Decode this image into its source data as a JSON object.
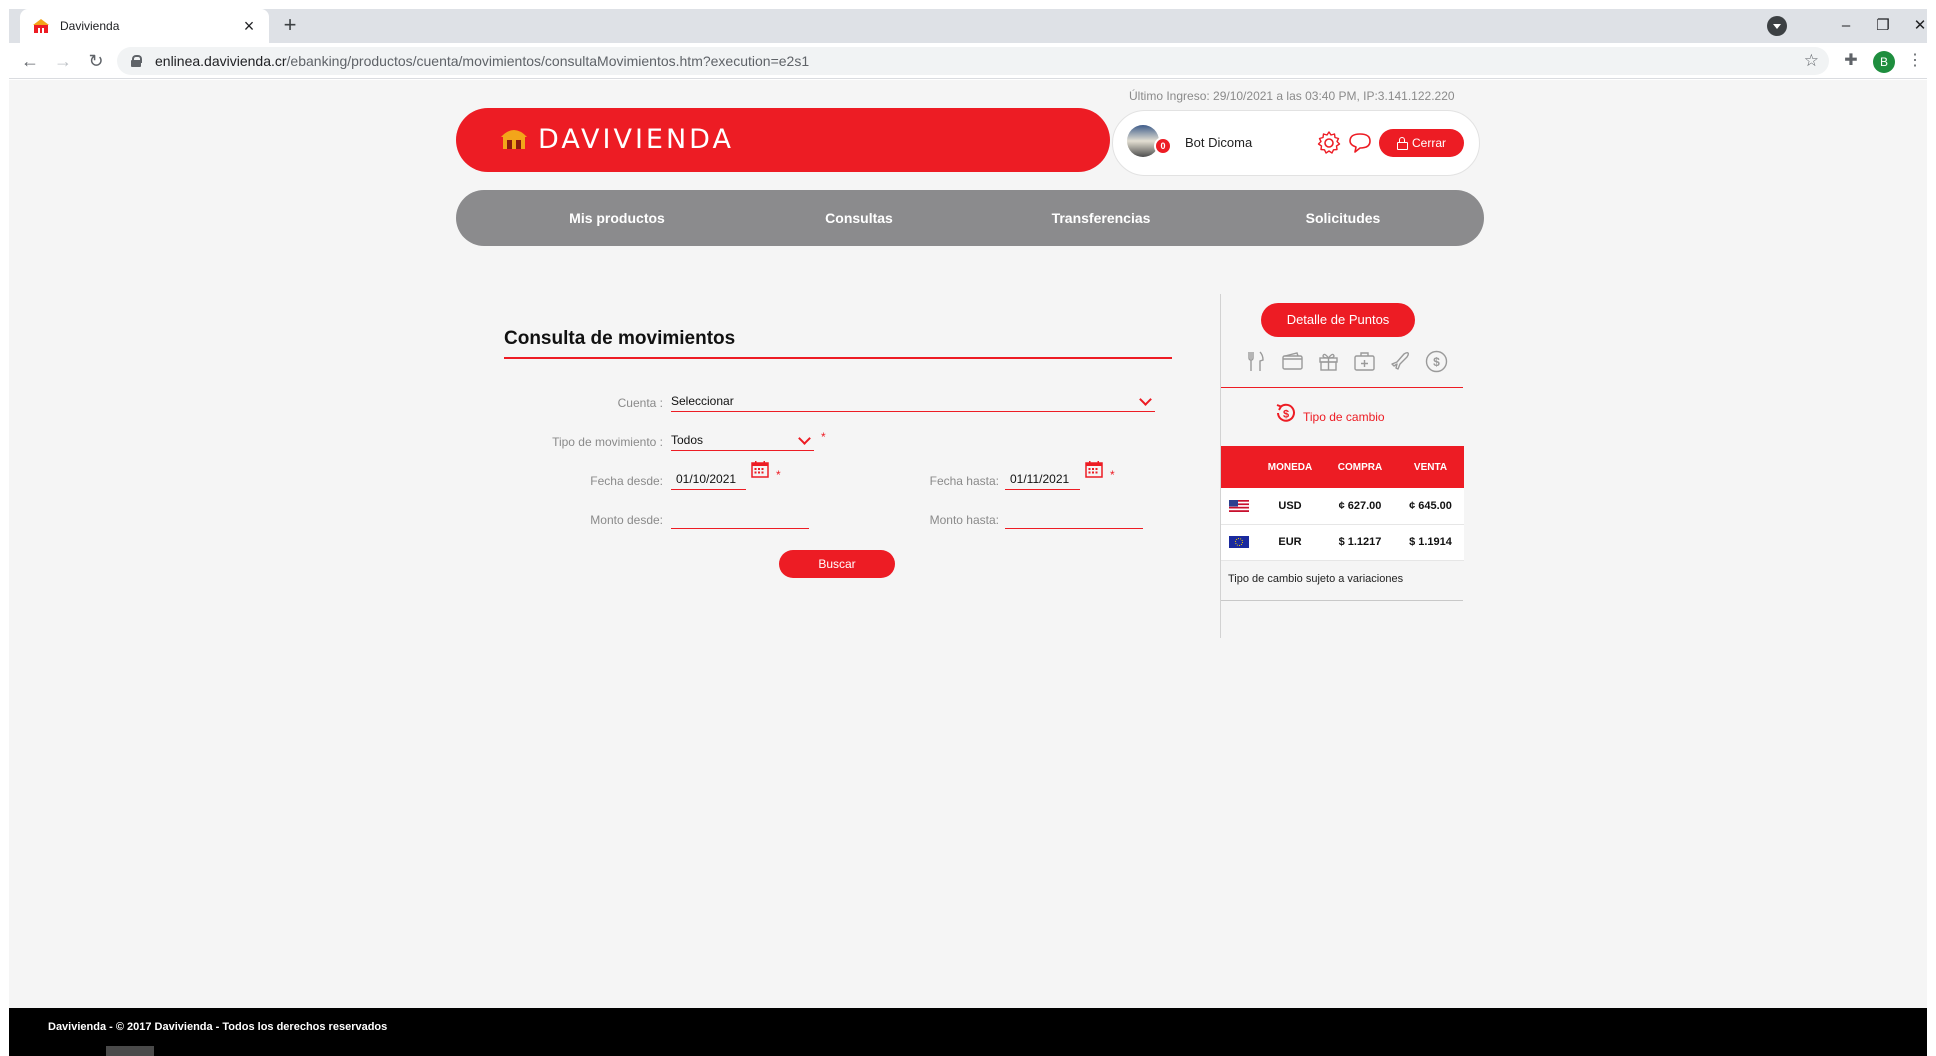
{
  "browser": {
    "tab_title": "Davivienda",
    "url_domain": "enlinea.davivienda.cr",
    "url_path": "/ebanking/productos/cuenta/movimientos/consultaMovimientos.htm?execution=e2s1",
    "profile_initial": "B"
  },
  "header": {
    "last_login": "Último Ingreso: 29/10/2021 a las 03:40 PM, IP:3.141.122.220",
    "brand": "DAVIVIENDA",
    "user_name": "Bot Dicoma",
    "notifications": "0",
    "logout_label": "Cerrar"
  },
  "nav": {
    "items": [
      "Mis productos",
      "Consultas",
      "Transferencias",
      "Solicitudes"
    ]
  },
  "form": {
    "title": "Consulta de movimientos",
    "cuenta_label": "Cuenta :",
    "cuenta_value": "Seleccionar",
    "tipo_label": "Tipo de movimiento :",
    "tipo_value": "Todos",
    "fecha_desde_label": "Fecha desde:",
    "fecha_desde_value": "01/10/2021",
    "fecha_hasta_label": "Fecha hasta:",
    "fecha_hasta_value": "01/11/2021",
    "monto_desde_label": "Monto desde:",
    "monto_hasta_label": "Monto hasta:",
    "required_mark": "*",
    "search_label": "Buscar"
  },
  "side": {
    "points_label": "Detalle de Puntos",
    "category_icons": [
      "fork-knife-icon",
      "wallet-icon",
      "gift-icon",
      "medical-kit-icon",
      "plane-icon",
      "dollar-coin-icon"
    ],
    "exchange_title": "Tipo de cambio",
    "table": {
      "headers": [
        "MONEDA",
        "COMPRA",
        "VENTA"
      ],
      "rows": [
        {
          "currency": "USD",
          "buy": "¢ 627.00",
          "sell": "¢ 645.00"
        },
        {
          "currency": "EUR",
          "buy": "$ 1.1217",
          "sell": "$ 1.1914"
        }
      ]
    },
    "note": "Tipo de cambio sujeto a variaciones"
  },
  "footer": {
    "text": "Davivienda - © 2017 Davivienda - Todos los derechos reservados"
  },
  "colors": {
    "brand_red": "#ed1c24",
    "nav_gray": "#8b8b8d",
    "page_bg": "#f5f5f5"
  }
}
